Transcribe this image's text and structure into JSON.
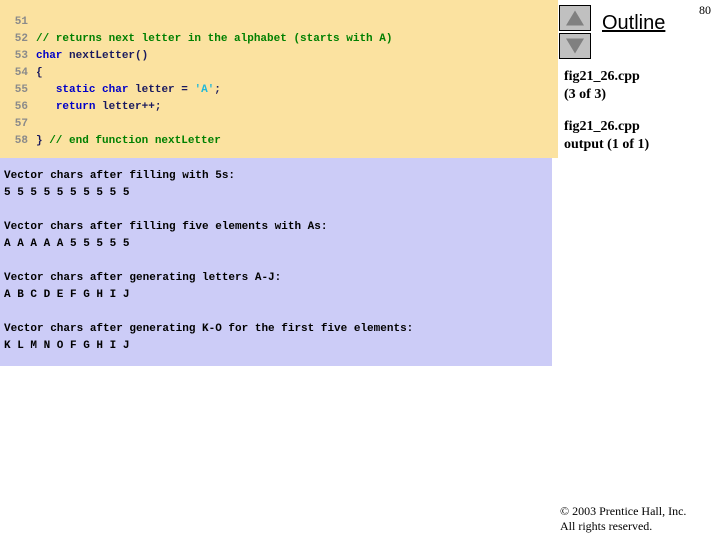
{
  "page_number": "80",
  "code_panel": {
    "lines": [
      {
        "num": "51",
        "tokens": []
      },
      {
        "num": "52",
        "tokens": [
          {
            "t": "comment",
            "s": "// returns next letter in the alphabet (starts with A)"
          }
        ]
      },
      {
        "num": "53",
        "tokens": [
          {
            "t": "keyword",
            "s": "char"
          },
          {
            "t": "plain",
            "s": " "
          },
          {
            "t": "ident",
            "s": "nextLetter()"
          }
        ]
      },
      {
        "num": "54",
        "tokens": [
          {
            "t": "plain",
            "s": "{"
          }
        ]
      },
      {
        "num": "55",
        "tokens": [
          {
            "t": "plain",
            "s": "   "
          },
          {
            "t": "keyword",
            "s": "static char"
          },
          {
            "t": "plain",
            "s": " "
          },
          {
            "t": "ident",
            "s": "letter"
          },
          {
            "t": "plain",
            "s": " = "
          },
          {
            "t": "string",
            "s": "'A'"
          },
          {
            "t": "plain",
            "s": ";"
          }
        ]
      },
      {
        "num": "56",
        "tokens": [
          {
            "t": "plain",
            "s": "   "
          },
          {
            "t": "keyword",
            "s": "return"
          },
          {
            "t": "plain",
            "s": " "
          },
          {
            "t": "ident",
            "s": "letter"
          },
          {
            "t": "plain",
            "s": "++;"
          }
        ]
      },
      {
        "num": "57",
        "tokens": []
      },
      {
        "num": "58",
        "tokens": [
          {
            "t": "plain",
            "s": "} "
          },
          {
            "t": "comment",
            "s": "// end function nextLetter"
          }
        ]
      }
    ]
  },
  "output_panel": {
    "lines": [
      "Vector chars after filling with 5s:",
      "5 5 5 5 5 5 5 5 5 5",
      "",
      "Vector chars after filling five elements with As:",
      "A A A A A 5 5 5 5 5",
      "",
      "Vector chars after generating letters A-J:",
      "A B C D E F G H I J",
      "",
      "Vector chars after generating K-O for the first five elements:",
      "K L M N O F G H I J"
    ]
  },
  "sidebar": {
    "title": "Outline",
    "nav": {
      "up_icon": "triangle-up-icon",
      "down_icon": "triangle-down-icon"
    },
    "items": [
      {
        "line1": "fig21_26.cpp",
        "line2": "(3 of 3)"
      },
      {
        "line1": "fig21_26.cpp",
        "line2": "output (1 of 1)"
      }
    ]
  },
  "footer": {
    "line1": "© 2003 Prentice Hall, Inc.",
    "line2": "All rights reserved."
  },
  "colors": {
    "code_bg": "#fbe2a0",
    "output_bg": "#ccccf7",
    "comment": "#008000",
    "keyword": "#0000c8",
    "identifier": "#1a1a5e",
    "string": "#21b8d8",
    "line_number": "#8a8a8a"
  }
}
